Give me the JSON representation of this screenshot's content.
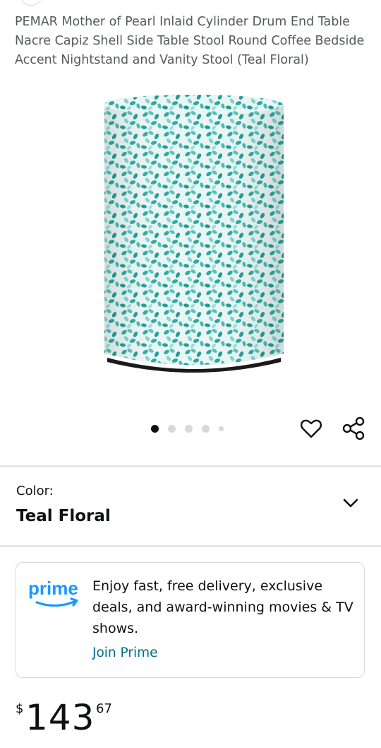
{
  "product": {
    "title": "PEMAR Mother of Pearl Inlaid Cylinder Drum End Table Nacre Capiz Shell Side Table Stool Round Coffee Bedside Accent Nightstand and Vanity Stool (Teal Floral)",
    "image_icon": "teal-floral-drum-table-image"
  },
  "carousel": {
    "total_dots": 5,
    "active_index": 0
  },
  "actions": {
    "wishlist_icon": "heart-outline-icon",
    "share_icon": "share-icon"
  },
  "color": {
    "label": "Color:",
    "value": "Teal Floral",
    "chevron_icon": "chevron-down-icon"
  },
  "prime": {
    "logo_text": "prime",
    "message": "Enjoy fast, free delivery, exclusive deals, and award-winning movies & TV shows.",
    "join_label": "Join Prime",
    "brand_color": "#1a98ff",
    "link_color": "#007185"
  },
  "price": {
    "symbol": "$",
    "whole": "143",
    "fraction": "67"
  },
  "colors": {
    "teal_primary": "#2aa7a3",
    "teal_light": "#7fd3cc",
    "text_primary": "#0f1111",
    "text_secondary": "#565959",
    "divider": "#e3e6e6"
  }
}
